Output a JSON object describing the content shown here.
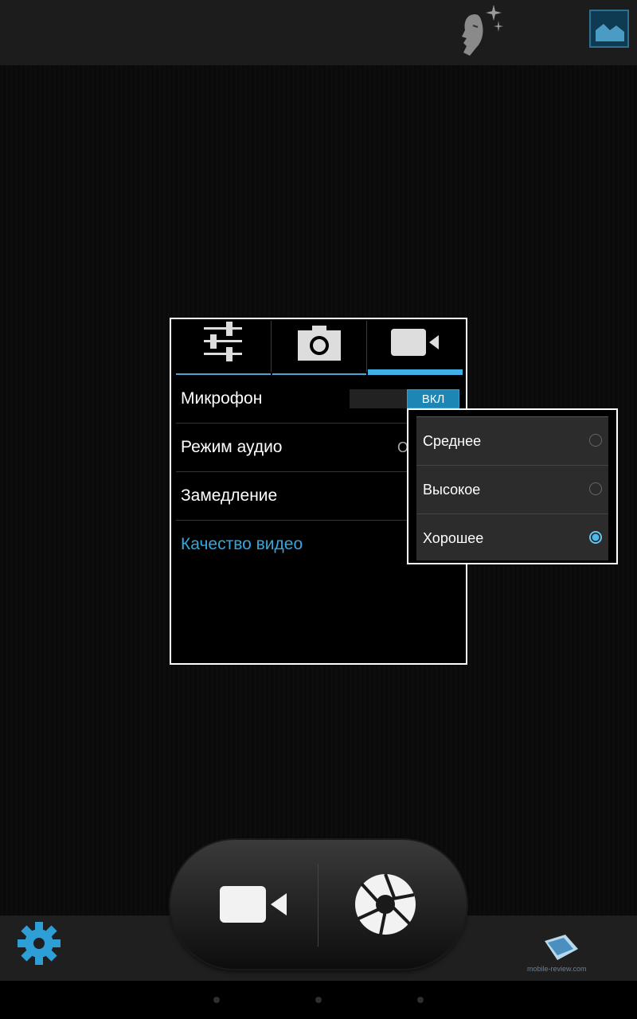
{
  "top_bar": {
    "scene_icon": "face-sparkle-icon",
    "gallery_icon": "image-thumbnail-icon"
  },
  "settings_panel": {
    "tabs": [
      {
        "name": "general-settings",
        "icon": "sliders-icon",
        "active": false
      },
      {
        "name": "photo-settings",
        "icon": "camera-icon",
        "active": false
      },
      {
        "name": "video-settings",
        "icon": "video-camera-icon",
        "active": true
      }
    ],
    "rows": [
      {
        "label": "Микрофон",
        "toggle_on_label": "ВКЛ"
      },
      {
        "label": "Режим аудио",
        "value_partial": "О"
      },
      {
        "label": "Замедление"
      },
      {
        "label": "Качество видео",
        "highlighted": true
      }
    ]
  },
  "quality_popup": {
    "options": [
      {
        "label": "Среднее",
        "selected": false
      },
      {
        "label": "Высокое",
        "selected": false
      },
      {
        "label": "Хорошее",
        "selected": true
      }
    ]
  },
  "bottom_bar": {
    "settings_icon": "gear-icon",
    "video_mode_icon": "video-camera-icon",
    "shutter_icon": "aperture-icon",
    "watermark_text": "mobile-review.com"
  },
  "colors": {
    "accent": "#33a7dc",
    "panel_bg": "#000000",
    "popup_bg": "#2c2c2c"
  }
}
